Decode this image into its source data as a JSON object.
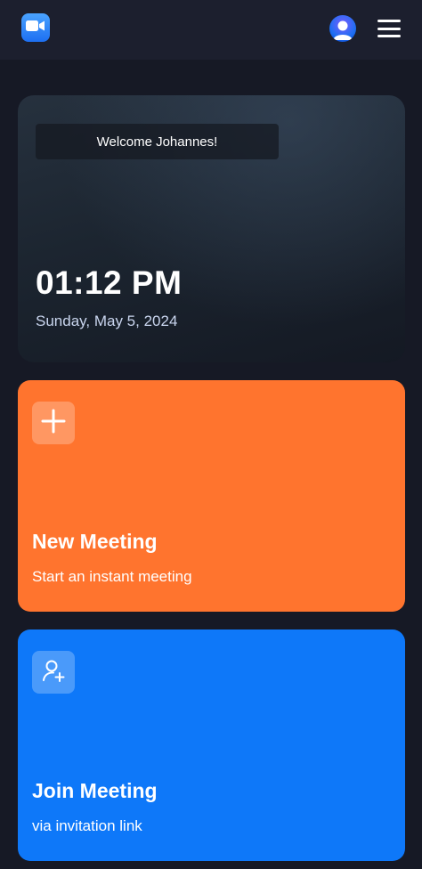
{
  "header": {
    "logo_icon": "video-camera-icon",
    "avatar_icon": "user-avatar-icon",
    "menu_icon": "hamburger-menu-icon"
  },
  "hero": {
    "welcome": "Welcome Johannes!",
    "time": "01:12 PM",
    "date": "Sunday, May 5, 2024"
  },
  "actions": {
    "new_meeting": {
      "icon": "plus-icon",
      "title": "New Meeting",
      "subtitle": "Start an instant meeting",
      "color": "#ff742e"
    },
    "join_meeting": {
      "icon": "add-user-icon",
      "title": "Join Meeting",
      "subtitle": "via invitation link",
      "color": "#0e78f9"
    }
  },
  "colors": {
    "background": "#161925",
    "topbar": "#1c1f2e",
    "accent_blue": "#0e78f9",
    "accent_orange": "#ff742e"
  }
}
